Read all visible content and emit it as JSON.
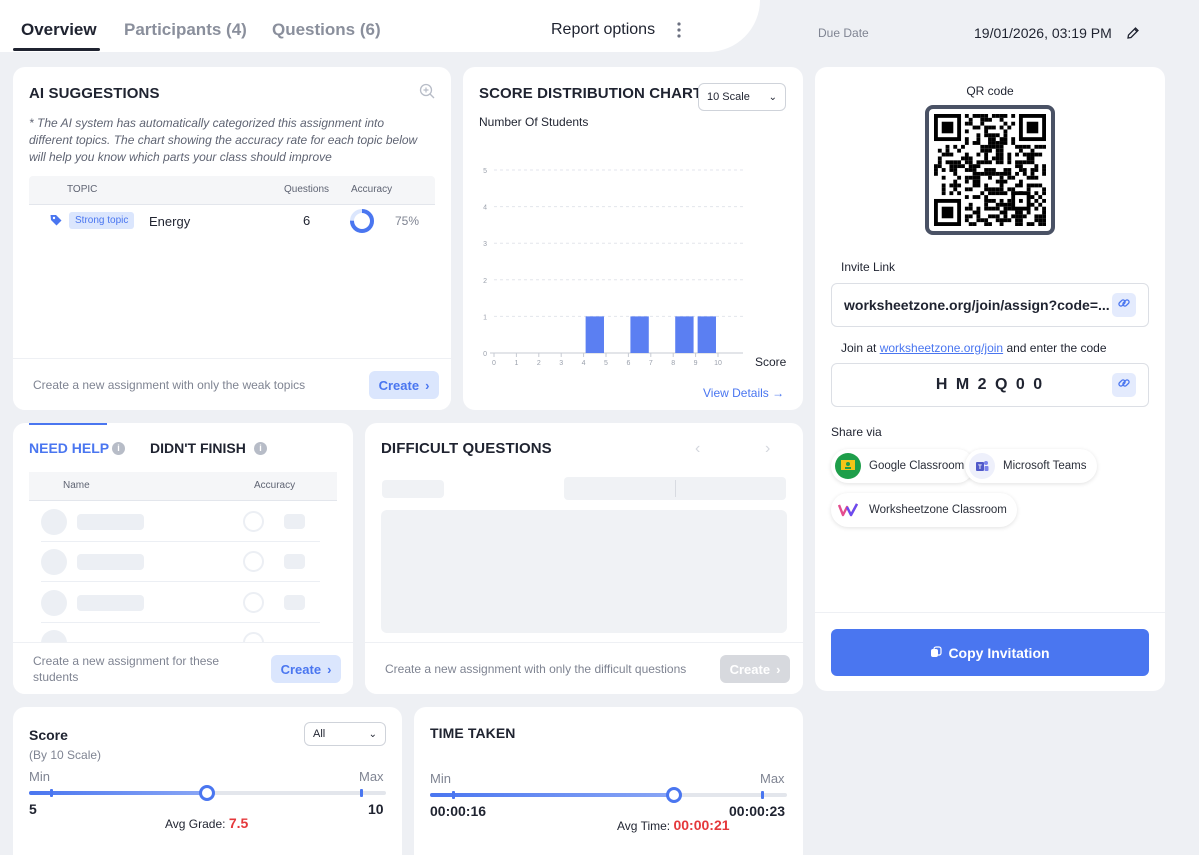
{
  "tabs": [
    {
      "label": "Overview"
    },
    {
      "label": "Participants (4)"
    },
    {
      "label": "Questions (6)"
    }
  ],
  "report_options_label": "Report options",
  "due_date": {
    "label": "Due Date",
    "value": "19/01/2026, 03:19 PM"
  },
  "ai_suggestions": {
    "title": "AI SUGGESTIONS",
    "description": "* The AI system has automatically categorized this assignment into different topics. The chart showing the accuracy rate for each topic below will help you know which parts your class should improve",
    "headers": {
      "topic": "TOPIC",
      "questions": "Questions",
      "accuracy": "Accuracy"
    },
    "rows": [
      {
        "badge": "Strong topic",
        "topic": "Energy",
        "questions": "6",
        "accuracy": "75%",
        "accuracy_value": 0.75
      }
    ],
    "footer_text": "Create a new assignment with only the weak topics",
    "create_label": "Create"
  },
  "score_chart": {
    "title": "SCORE DISTRIBUTION CHART",
    "scale_option": "10 Scale",
    "ylabel": "Number Of Students",
    "xlabel": "Score",
    "view_details": "View Details →"
  },
  "chart_data": {
    "type": "bar",
    "categories": [
      "0",
      "1",
      "2",
      "3",
      "4",
      "5",
      "6",
      "7",
      "8",
      "9",
      "10"
    ],
    "bar_positions": [
      4.5,
      6.5,
      8.5,
      9.5
    ],
    "values": [
      1,
      1,
      1,
      1
    ],
    "xlim": [
      0,
      10
    ],
    "ylim": [
      0,
      5
    ],
    "yticks": [
      "0",
      "1",
      "2",
      "3",
      "4",
      "5"
    ],
    "xticks": [
      "0",
      "1",
      "2",
      "3",
      "4",
      "5",
      "6",
      "7",
      "8",
      "9",
      "10"
    ],
    "title": "SCORE DISTRIBUTION CHART",
    "xlabel": "Score",
    "ylabel": "Number Of Students",
    "bar_color": "#5b7ff2",
    "grid": true
  },
  "need_help": {
    "tab_active": "NEED HELP",
    "tab_other": "DIDN'T FINISH",
    "headers": {
      "name": "Name",
      "accuracy": "Accuracy"
    },
    "footer_text": "Create a new assignment for these students",
    "create_label": "Create"
  },
  "difficult_questions": {
    "title": "DIFFICULT QUESTIONS",
    "footer_text": "Create a new assignment with only the difficult questions",
    "create_label": "Create"
  },
  "invite": {
    "qr_label": "QR code",
    "invite_link_label": "Invite Link",
    "invite_link": "worksheetzone.org/join/assign?code=...",
    "join_prefix": "Join at ",
    "join_link": "worksheetzone.org/join",
    "join_suffix": " and enter the code",
    "code": "H M 2 Q 0 0",
    "share_label": "Share via",
    "share_google": "Google Classroom",
    "share_teams": "Microsoft Teams",
    "share_wz": "Worksheetzone Classroom",
    "copy_invitation": "Copy Invitation"
  },
  "score": {
    "title": "Score",
    "subtitle": "(By 10 Scale)",
    "filter": "All",
    "min_label": "Min",
    "max_label": "Max",
    "min_value": "5",
    "max_value": "10",
    "avg_label": "Avg Grade: ",
    "avg_value": "7.5"
  },
  "time_taken": {
    "title": "TIME TAKEN",
    "min_label": "Min",
    "max_label": "Max",
    "min_value": "00:00:16",
    "max_value": "00:00:23",
    "avg_label": "Avg Time: ",
    "avg_value": "00:00:21"
  },
  "colors": {
    "accent": "#4a76f0",
    "danger": "#e5383b",
    "background": "#eef0f4"
  }
}
